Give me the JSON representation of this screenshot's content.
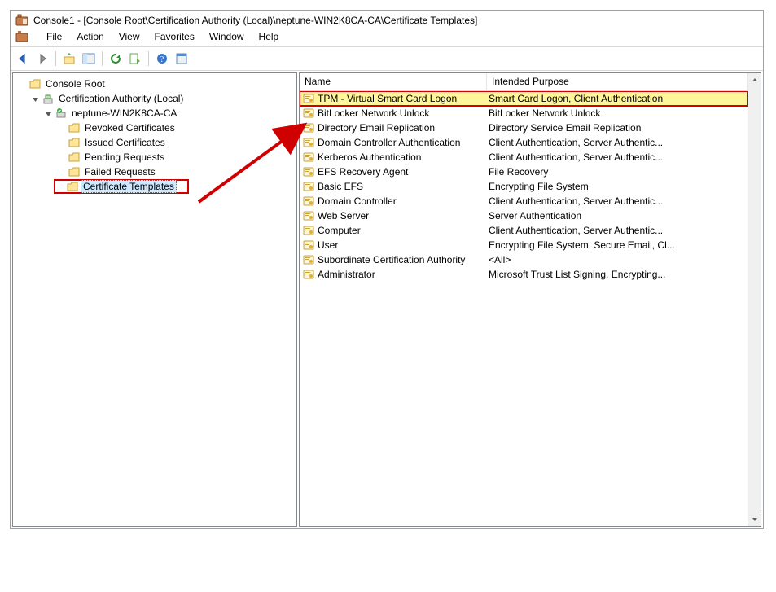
{
  "window": {
    "title": "Console1 - [Console Root\\Certification Authority (Local)\\neptune-WIN2K8CA-CA\\Certificate Templates]"
  },
  "menubar": [
    "File",
    "Action",
    "View",
    "Favorites",
    "Window",
    "Help"
  ],
  "tree": {
    "root": "Console Root",
    "ca_local": "Certification Authority (Local)",
    "ca_server": "neptune-WIN2K8CA-CA",
    "children": [
      "Revoked Certificates",
      "Issued Certificates",
      "Pending Requests",
      "Failed Requests",
      "Certificate Templates"
    ]
  },
  "list": {
    "col_name": "Name",
    "col_purpose": "Intended Purpose",
    "rows": [
      {
        "name": "TPM - Virtual Smart Card Logon",
        "purpose": "Smart Card Logon, Client Authentication",
        "highlight": true
      },
      {
        "name": "BitLocker Network Unlock",
        "purpose": "BitLocker Network Unlock"
      },
      {
        "name": "Directory Email Replication",
        "purpose": "Directory Service Email Replication"
      },
      {
        "name": "Domain Controller Authentication",
        "purpose": "Client Authentication, Server Authentic..."
      },
      {
        "name": "Kerberos Authentication",
        "purpose": "Client Authentication, Server Authentic..."
      },
      {
        "name": "EFS Recovery Agent",
        "purpose": "File Recovery"
      },
      {
        "name": "Basic EFS",
        "purpose": "Encrypting File System"
      },
      {
        "name": "Domain Controller",
        "purpose": "Client Authentication, Server Authentic..."
      },
      {
        "name": "Web Server",
        "purpose": "Server Authentication"
      },
      {
        "name": "Computer",
        "purpose": "Client Authentication, Server Authentic..."
      },
      {
        "name": "User",
        "purpose": "Encrypting File System, Secure Email, Cl..."
      },
      {
        "name": "Subordinate Certification Authority",
        "purpose": "<All>"
      },
      {
        "name": "Administrator",
        "purpose": "Microsoft Trust List Signing, Encrypting..."
      }
    ]
  }
}
